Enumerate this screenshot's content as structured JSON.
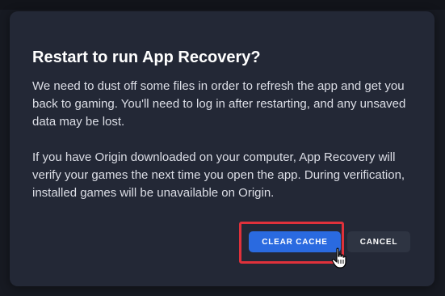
{
  "dialog": {
    "title": "Restart to run App Recovery?",
    "paragraph1": "We need to dust off some files in order to refresh the app and get you back to gaming. You'll need to log in after restarting, and any unsaved data may be lost.",
    "paragraph2": "If you have Origin downloaded on your computer, App Recovery will verify your games the next time you open the app. During verification, installed games will be unavailable on Origin.",
    "primary_button": "CLEAR CACHE",
    "secondary_button": "CANCEL"
  },
  "colors": {
    "dialog_bg": "#232836",
    "primary": "#2a6ae0",
    "highlight": "#e0313b"
  },
  "icons": {
    "cursor": "hand-pointer-icon"
  }
}
